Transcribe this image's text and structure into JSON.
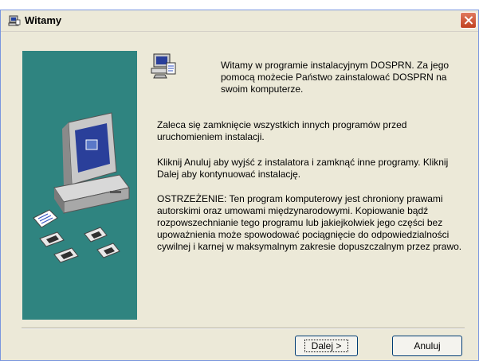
{
  "window": {
    "title": "Witamy",
    "icons": {
      "app": "installer-icon",
      "close": "close-icon"
    }
  },
  "content": {
    "welcome": "Witamy w programie instalacyjnym DOSPRN. Za jego pomocą możecie Państwo zainstalować DOSPRN na swoim komputerze.",
    "paragraph_close": "Zaleca się zamknięcie wszystkich innych programów przed uruchomieniem instalacji.",
    "paragraph_buttons": "Kliknij Anuluj aby wyjść z instalatora i zamknąć inne programy. Kliknij Dalej aby kontynuować instalację.",
    "paragraph_warning": "OSTRZEŻENIE: Ten program komputerowy jest chroniony prawami autorskimi oraz umowami międzynarodowymi. Kopiowanie bądź rozpowszechnianie tego programu lub jakiejkolwiek jego części bez upoważnienia może spowodować pociągnięcie do odpowiedzialności cywilnej i karnej w maksymalnym zakresie dopuszczalnym przez prawo."
  },
  "buttons": {
    "next": "Dalej >",
    "cancel": "Anuluj"
  },
  "colors": {
    "side_panel": "#2f8480",
    "dialog_bg": "#ece9d8"
  }
}
